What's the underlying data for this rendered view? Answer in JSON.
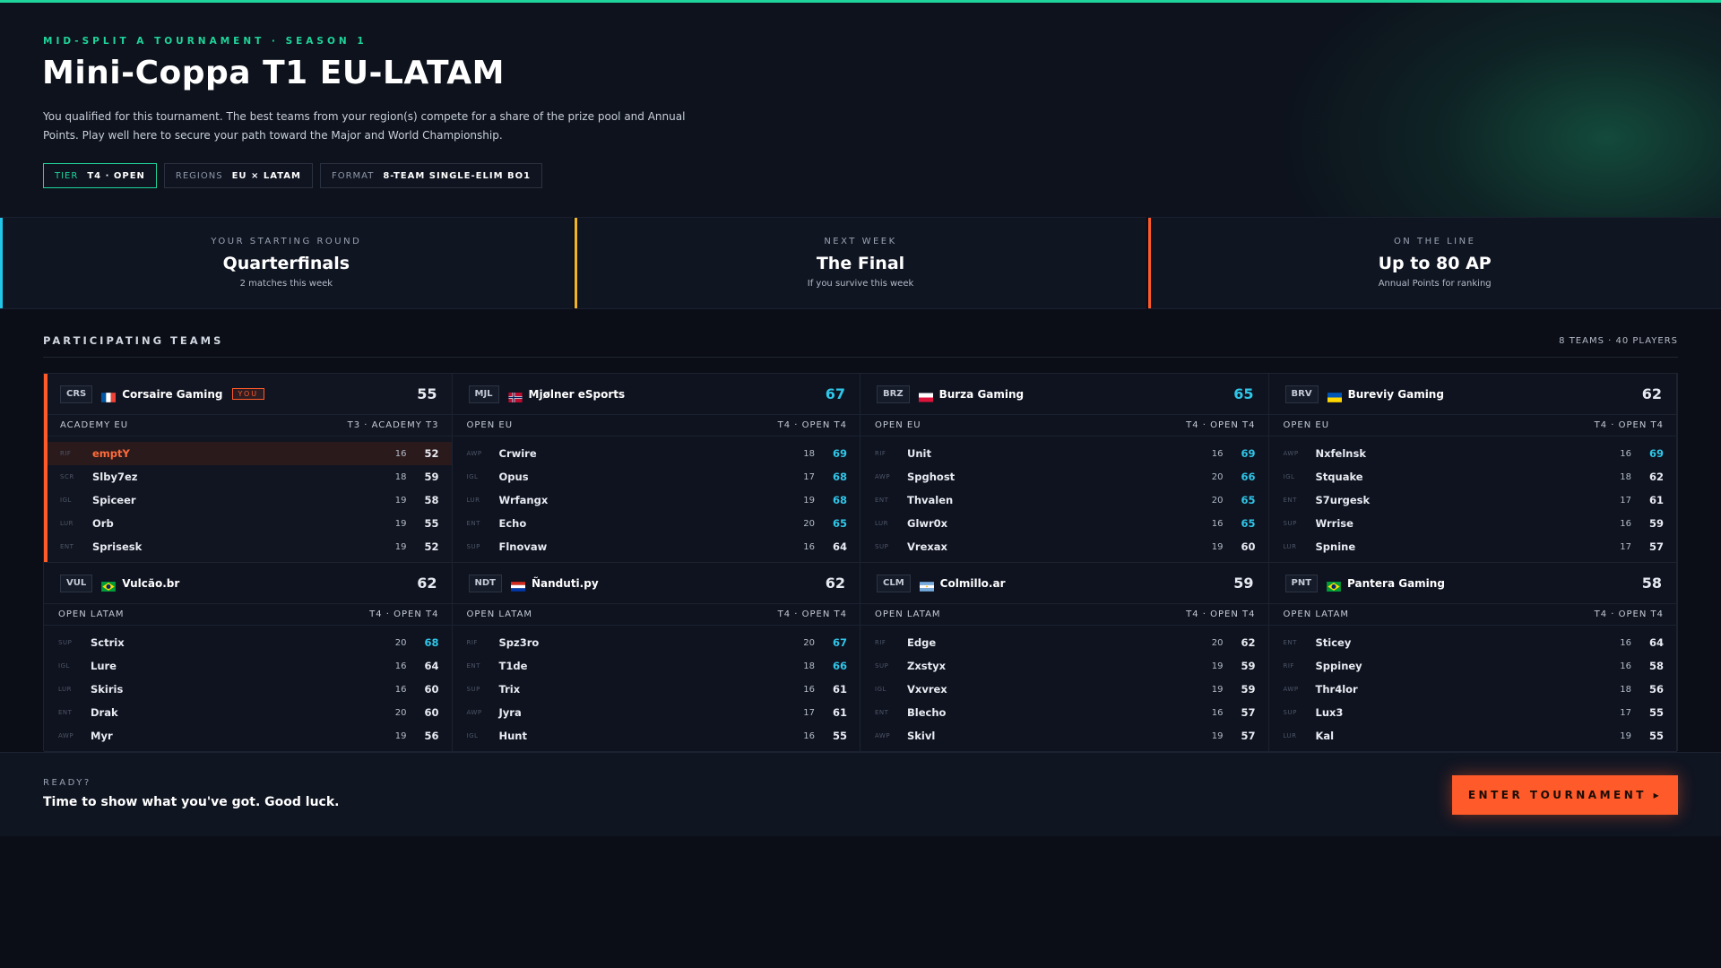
{
  "hero": {
    "eyebrow": "MID-SPLIT A TOURNAMENT · SEASON 1",
    "title": "Mini-Coppa T1 EU-LATAM",
    "description": "You qualified for this tournament. The best teams from your region(s) compete for a share of the prize pool and Annual Points. Play well here to secure your path toward the Major and World Championship.",
    "chips": [
      {
        "key": "TIER",
        "value": "T4 · OPEN"
      },
      {
        "key": "REGIONS",
        "value": "EU × LATAM"
      },
      {
        "key": "FORMAT",
        "value": "8-TEAM SINGLE-ELIM BO1"
      }
    ]
  },
  "stats": [
    {
      "label": "YOUR STARTING ROUND",
      "value": "Quarterfinals",
      "sub": "2 matches this week"
    },
    {
      "label": "NEXT WEEK",
      "value": "The Final",
      "sub": "If you survive this week"
    },
    {
      "label": "ON THE LINE",
      "value": "Up to 80 AP",
      "sub": "Annual Points for ranking"
    }
  ],
  "teams_section": {
    "title": "PARTICIPATING TEAMS",
    "count": "8 TEAMS · 40 PLAYERS",
    "you_label": "YOU"
  },
  "colors": {
    "accent_green": "#1fd49a",
    "accent_orange": "#ff5a2a",
    "highlight_cyan": "#2fc6e8"
  },
  "teams": [
    {
      "tag": "CRS",
      "flag": "fr",
      "name": "Corsaire Gaming",
      "you": true,
      "score": "55",
      "league": "ACADEMY EU",
      "tier": "T3 · ACADEMY T3",
      "players": [
        {
          "role": "RIF",
          "name": "emptY",
          "age": "16",
          "ovr": "52",
          "me": true
        },
        {
          "role": "SCR",
          "name": "Slby7ez",
          "age": "18",
          "ovr": "59"
        },
        {
          "role": "IGL",
          "name": "Spiceer",
          "age": "19",
          "ovr": "58"
        },
        {
          "role": "LUR",
          "name": "Orb",
          "age": "19",
          "ovr": "55"
        },
        {
          "role": "ENT",
          "name": "Sprisesk",
          "age": "19",
          "ovr": "52"
        }
      ]
    },
    {
      "tag": "MJL",
      "flag": "no",
      "name": "Mjølner eSports",
      "score": "67",
      "score_hi": true,
      "league": "OPEN EU",
      "tier": "T4 · OPEN T4",
      "players": [
        {
          "role": "AWP",
          "name": "Crwire",
          "age": "18",
          "ovr": "69",
          "hi": true
        },
        {
          "role": "IGL",
          "name": "Opus",
          "age": "17",
          "ovr": "68",
          "hi": true
        },
        {
          "role": "LUR",
          "name": "Wrfangx",
          "age": "19",
          "ovr": "68",
          "hi": true
        },
        {
          "role": "ENT",
          "name": "Echo",
          "age": "20",
          "ovr": "65",
          "hi": true
        },
        {
          "role": "SUP",
          "name": "Flnovaw",
          "age": "16",
          "ovr": "64"
        }
      ]
    },
    {
      "tag": "BRZ",
      "flag": "pl",
      "name": "Burza Gaming",
      "score": "65",
      "score_hi": true,
      "league": "OPEN EU",
      "tier": "T4 · OPEN T4",
      "players": [
        {
          "role": "RIF",
          "name": "Unit",
          "age": "16",
          "ovr": "69",
          "hi": true
        },
        {
          "role": "AWP",
          "name": "Spghost",
          "age": "20",
          "ovr": "66",
          "hi": true
        },
        {
          "role": "ENT",
          "name": "Thvalen",
          "age": "20",
          "ovr": "65",
          "hi": true
        },
        {
          "role": "LUR",
          "name": "Glwr0x",
          "age": "16",
          "ovr": "65",
          "hi": true
        },
        {
          "role": "SUP",
          "name": "Vrexax",
          "age": "19",
          "ovr": "60"
        }
      ]
    },
    {
      "tag": "BRV",
      "flag": "ua",
      "name": "Bureviy Gaming",
      "score": "62",
      "league": "OPEN EU",
      "tier": "T4 · OPEN T4",
      "players": [
        {
          "role": "AWP",
          "name": "Nxfelnsk",
          "age": "16",
          "ovr": "69",
          "hi": true
        },
        {
          "role": "IGL",
          "name": "Stquake",
          "age": "18",
          "ovr": "62"
        },
        {
          "role": "ENT",
          "name": "S7urgesk",
          "age": "17",
          "ovr": "61"
        },
        {
          "role": "SUP",
          "name": "Wrrise",
          "age": "16",
          "ovr": "59"
        },
        {
          "role": "LUR",
          "name": "Spnine",
          "age": "17",
          "ovr": "57"
        }
      ]
    },
    {
      "tag": "VUL",
      "flag": "br",
      "name": "Vulcão.br",
      "score": "62",
      "league": "OPEN LATAM",
      "tier": "T4 · OPEN T4",
      "players": [
        {
          "role": "SUP",
          "name": "Sctrix",
          "age": "20",
          "ovr": "68",
          "hi": true
        },
        {
          "role": "IGL",
          "name": "Lure",
          "age": "16",
          "ovr": "64"
        },
        {
          "role": "LUR",
          "name": "Skiris",
          "age": "16",
          "ovr": "60"
        },
        {
          "role": "ENT",
          "name": "Drak",
          "age": "20",
          "ovr": "60"
        },
        {
          "role": "AWP",
          "name": "Myr",
          "age": "19",
          "ovr": "56"
        }
      ]
    },
    {
      "tag": "NDT",
      "flag": "py",
      "name": "Ñanduti.py",
      "score": "62",
      "league": "OPEN LATAM",
      "tier": "T4 · OPEN T4",
      "players": [
        {
          "role": "RIF",
          "name": "Spz3ro",
          "age": "20",
          "ovr": "67",
          "hi": true
        },
        {
          "role": "ENT",
          "name": "T1de",
          "age": "18",
          "ovr": "66",
          "hi": true
        },
        {
          "role": "SUP",
          "name": "Trix",
          "age": "16",
          "ovr": "61"
        },
        {
          "role": "AWP",
          "name": "Jyra",
          "age": "17",
          "ovr": "61"
        },
        {
          "role": "IGL",
          "name": "Hunt",
          "age": "16",
          "ovr": "55"
        }
      ]
    },
    {
      "tag": "CLM",
      "flag": "ar",
      "name": "Colmillo.ar",
      "score": "59",
      "league": "OPEN LATAM",
      "tier": "T4 · OPEN T4",
      "players": [
        {
          "role": "RIF",
          "name": "Edge",
          "age": "20",
          "ovr": "62"
        },
        {
          "role": "SUP",
          "name": "Zxstyx",
          "age": "19",
          "ovr": "59"
        },
        {
          "role": "IGL",
          "name": "Vxvrex",
          "age": "19",
          "ovr": "59"
        },
        {
          "role": "ENT",
          "name": "Blecho",
          "age": "16",
          "ovr": "57"
        },
        {
          "role": "AWP",
          "name": "Skivl",
          "age": "19",
          "ovr": "57"
        }
      ]
    },
    {
      "tag": "PNT",
      "flag": "br",
      "name": "Pantera Gaming",
      "score": "58",
      "league": "OPEN LATAM",
      "tier": "T4 · OPEN T4",
      "players": [
        {
          "role": "ENT",
          "name": "Sticey",
          "age": "16",
          "ovr": "64"
        },
        {
          "role": "RIF",
          "name": "Sppiney",
          "age": "16",
          "ovr": "58"
        },
        {
          "role": "AWP",
          "name": "Thr4lor",
          "age": "18",
          "ovr": "56"
        },
        {
          "role": "SUP",
          "name": "Lux3",
          "age": "17",
          "ovr": "55"
        },
        {
          "role": "LUR",
          "name": "Kal",
          "age": "19",
          "ovr": "55"
        }
      ]
    }
  ],
  "footer": {
    "ready": "READY?",
    "message": "Time to show what you've got. Good luck.",
    "cta": "ENTER TOURNAMENT ▸"
  }
}
